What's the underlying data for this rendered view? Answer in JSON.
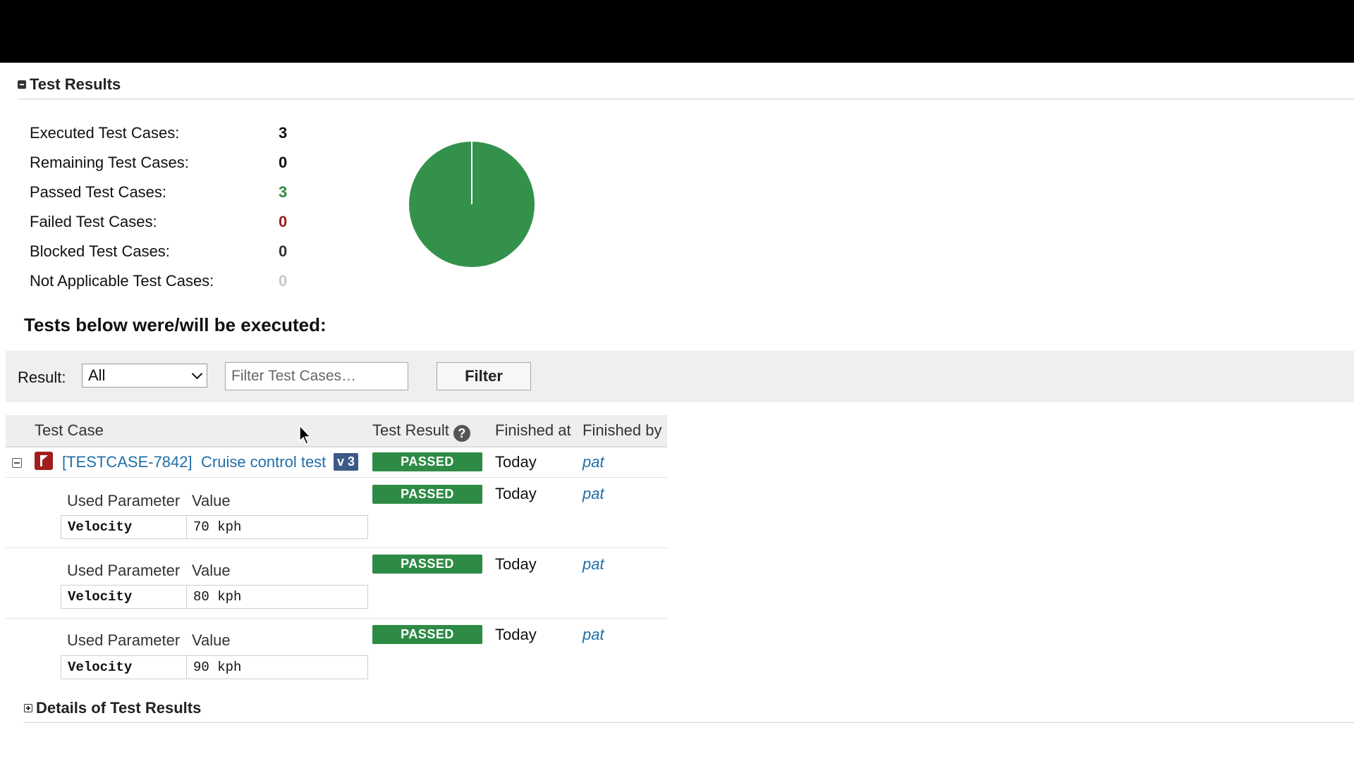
{
  "test_results": {
    "heading": "Test Results",
    "stats": [
      {
        "label": "Executed Test Cases:",
        "value": "3",
        "color": "#111111"
      },
      {
        "label": "Remaining Test Cases:",
        "value": "0",
        "color": "#111111"
      },
      {
        "label": "Passed Test Cases:",
        "value": "3",
        "color": "#2e8b45"
      },
      {
        "label": "Failed Test Cases:",
        "value": "0",
        "color": "#a11d1d"
      },
      {
        "label": "Blocked Test Cases:",
        "value": "0",
        "color": "#333333"
      },
      {
        "label": "Not Applicable Test Cases:",
        "value": "0",
        "color": "#c8c8c8"
      }
    ],
    "pie": {
      "slices": [
        {
          "name": "Passed",
          "value": 3,
          "color": "#33914b"
        }
      ]
    }
  },
  "tests_heading": "Tests below were/will be executed:",
  "filter": {
    "label": "Result:",
    "selected": "All",
    "placeholder": "Filter Test Cases…",
    "button": "Filter"
  },
  "table": {
    "columns": {
      "test_case": "Test Case",
      "test_result": "Test Result",
      "help": "?",
      "finished_at": "Finished at",
      "finished_by": "Finished by"
    },
    "main_row": {
      "id": "[TESTCASE-7842]",
      "name": "Cruise control test",
      "version": "v 3",
      "result": "PASSED",
      "finished_at": "Today",
      "finished_by": "pat"
    },
    "param_headers": {
      "param": "Used Parameter",
      "value": "Value"
    },
    "runs": [
      {
        "param": "Velocity",
        "value": "70 kph",
        "result": "PASSED",
        "finished_at": "Today",
        "finished_by": "pat"
      },
      {
        "param": "Velocity",
        "value": "80 kph",
        "result": "PASSED",
        "finished_at": "Today",
        "finished_by": "pat"
      },
      {
        "param": "Velocity",
        "value": "90 kph",
        "result": "PASSED",
        "finished_at": "Today",
        "finished_by": "pat"
      }
    ]
  },
  "details_heading": "Details of Test Results"
}
